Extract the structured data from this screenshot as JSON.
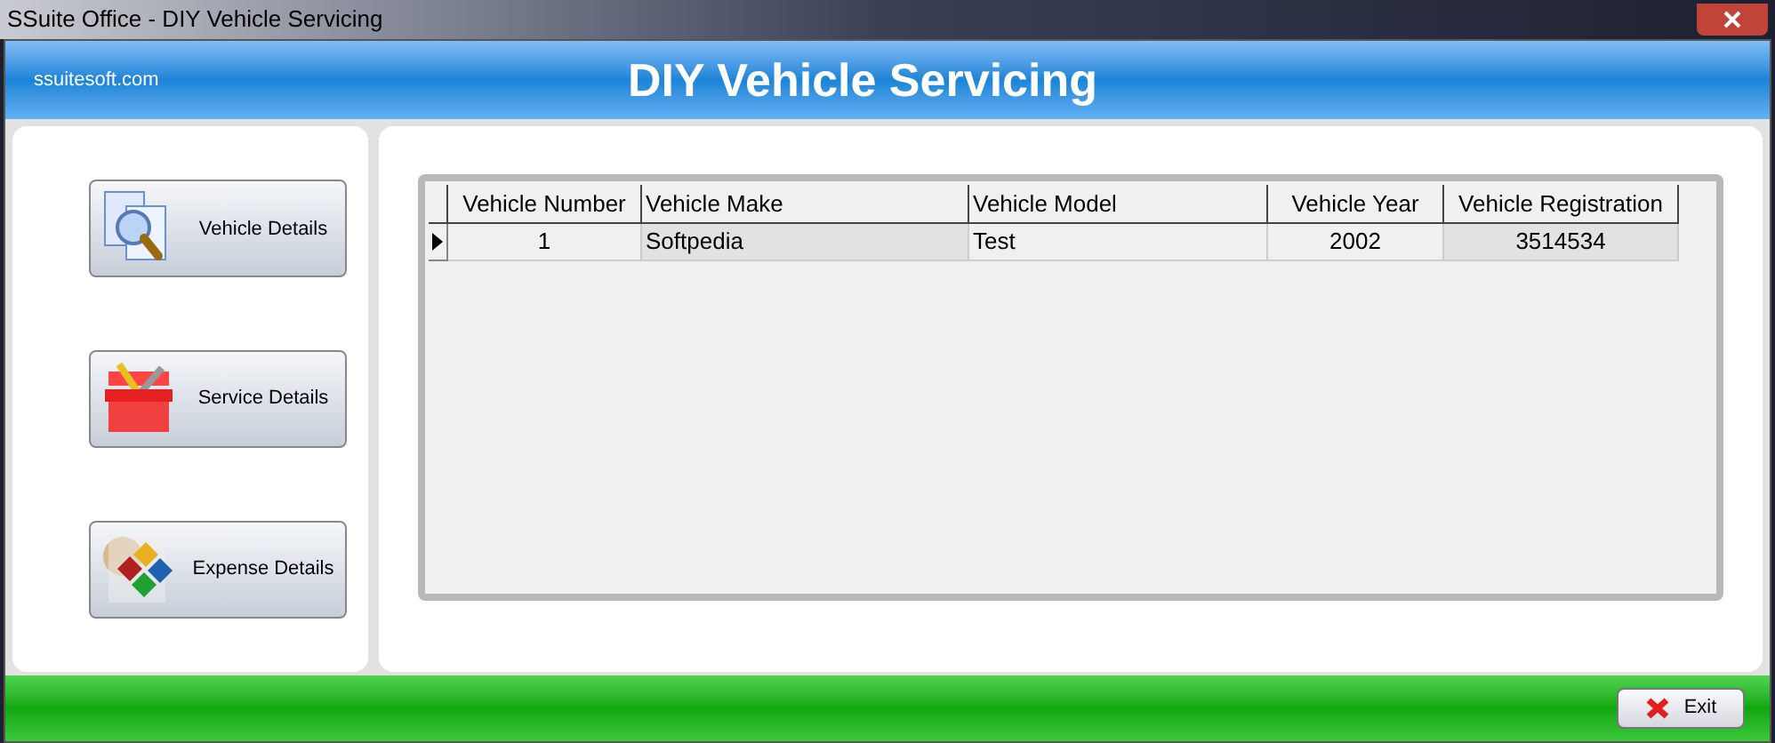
{
  "window": {
    "title": "SSuite Office - DIY Vehicle Servicing"
  },
  "header": {
    "site": "ssuitesoft.com",
    "title": "DIY Vehicle Servicing"
  },
  "nav_buttons": [
    {
      "kind": "vehicle",
      "label": "Vehicle Details"
    },
    {
      "kind": "service",
      "label": "Service Details"
    },
    {
      "kind": "expense",
      "label": "Expense Details"
    }
  ],
  "table": {
    "columns": [
      {
        "label": "Vehicle Number",
        "kind": "numeric"
      },
      {
        "label": "Vehicle Make",
        "kind": "text"
      },
      {
        "label": "Vehicle Model",
        "kind": "text"
      },
      {
        "label": "Vehicle Year",
        "kind": "numeric"
      },
      {
        "label": "Vehicle Registration",
        "kind": "numeric"
      }
    ],
    "rows": [
      {
        "selected": true,
        "cells": [
          "1",
          "Softpedia",
          "Test",
          "2002",
          "3514534"
        ]
      }
    ]
  },
  "footer": {
    "exit_label": "Exit"
  }
}
